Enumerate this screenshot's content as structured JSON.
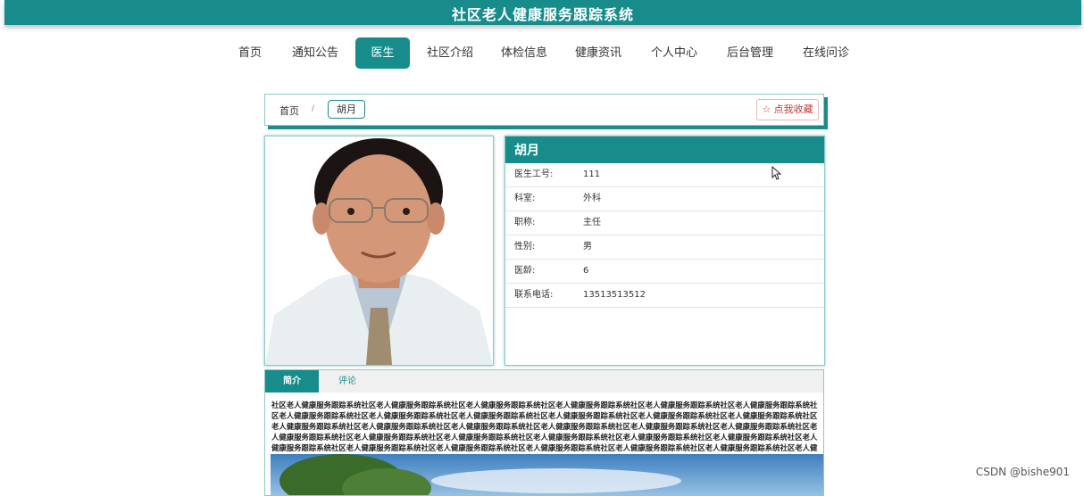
{
  "site": {
    "title": "社区老人健康服务跟踪系统"
  },
  "nav": {
    "items": [
      {
        "label": "首页"
      },
      {
        "label": "通知公告"
      },
      {
        "label": "医生"
      },
      {
        "label": "社区介绍"
      },
      {
        "label": "体检信息"
      },
      {
        "label": "健康资讯"
      },
      {
        "label": "个人中心"
      },
      {
        "label": "后台管理"
      },
      {
        "label": "在线问诊"
      }
    ],
    "active": "医生"
  },
  "breadcrumb": {
    "home": "首页",
    "separator": "/",
    "current": "胡月"
  },
  "favorite": {
    "label": "☆ 点我收藏"
  },
  "doctor": {
    "name": "胡月",
    "fields": [
      {
        "label": "医生工号:",
        "value": "111"
      },
      {
        "label": "科室:",
        "value": "外科"
      },
      {
        "label": "职称:",
        "value": "主任"
      },
      {
        "label": "性别:",
        "value": "男"
      },
      {
        "label": "医龄:",
        "value": "6"
      },
      {
        "label": "联系电话:",
        "value": "13513513512"
      }
    ]
  },
  "tabs": {
    "intro": "简介",
    "comments": "评论"
  },
  "intro_text": "社区老人健康服务跟踪系统社区老人健康服务跟踪系统社区老人健康服务跟踪系统社区老人健康服务跟踪系统社区老人健康服务跟踪系统社区老人健康服务跟踪系统社区老人健康服务跟踪系统社区老人健康服务跟踪系统社区老人健康服务跟踪系统社区老人健康服务跟踪系统社区老人健康服务跟踪系统社区老人健康服务跟踪系统社区老人健康服务跟踪系统社区老人健康服务跟踪系统社区老人健康服务跟踪系统社区老人健康服务跟踪系统社区老人健康服务跟踪系统社区老人健康服务跟踪系统社区老人健康服务跟踪系统社区老人健康服务跟踪系统社区老人健康服务跟踪系统社区老人健康服务跟踪系统社区老人健康服务跟踪系统社区老人健康服务跟踪系统社区老人健康服务跟踪系统社区老人健康服务跟踪系统社区老人健康服务跟踪系统社区老人健康服务跟踪系统社区老人健康服务跟踪系统社区老人健康服务跟踪系统社区老人健康服务跟踪系统社区老人健康服务跟踪系统社区老人健康服务跟踪系统社区老人健康服务跟踪系统社区老人健康服务跟踪系统",
  "watermark": "CSDN @bishe901",
  "colors": {
    "accent": "#178c8a",
    "favorite": "#c23b3b"
  }
}
